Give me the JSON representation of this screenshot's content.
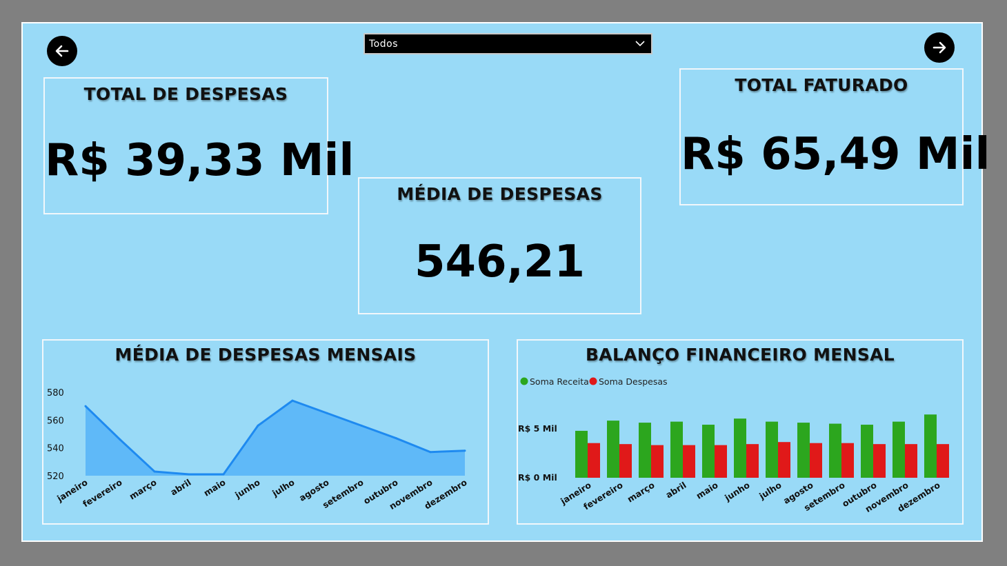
{
  "filter": {
    "selected": "Todos",
    "icon": "chevron-down-icon"
  },
  "nav": {
    "back_icon": "arrow-left-icon",
    "forward_icon": "arrow-right-icon"
  },
  "kpi": {
    "total_despesas": {
      "title": "TOTAL DE DESPESAS",
      "value": "R$ 39,33 Mil"
    },
    "total_faturado": {
      "title": "TOTAL FATURADO",
      "value": "R$ 65,49 Mil"
    },
    "media_despesas": {
      "title": "MÉDIA DE DESPESAS",
      "value": "546,21"
    }
  },
  "colors": {
    "background": "#99daf7",
    "area_fill": "#5fb9f8",
    "line": "#1e8af0",
    "receita": "#2ca61e",
    "despesas": "#e01919"
  },
  "chart_data": [
    {
      "type": "area",
      "title": "MÉDIA DE DESPESAS MENSAIS",
      "categories": [
        "janeiro",
        "fevereiro",
        "março",
        "abril",
        "maio",
        "junho",
        "julho",
        "agosto",
        "setembro",
        "outubro",
        "novembro",
        "dezembro"
      ],
      "values": [
        570,
        546,
        523,
        521,
        521,
        556,
        574,
        565,
        556,
        547,
        537,
        538
      ],
      "yticks": [
        "520",
        "540",
        "560",
        "580"
      ],
      "ylim": [
        520,
        580
      ],
      "grid": false
    },
    {
      "type": "bar",
      "title": "BALANÇO FINANCEIRO MENSAL",
      "categories": [
        "janeiro",
        "fevereiro",
        "março",
        "abril",
        "maio",
        "junho",
        "julho",
        "agosto",
        "setembro",
        "outubro",
        "novembro",
        "dezembro"
      ],
      "series": [
        {
          "name": "Soma Receita",
          "values": [
            4.6,
            5.6,
            5.4,
            5.5,
            5.2,
            5.8,
            5.5,
            5.4,
            5.3,
            5.2,
            5.5,
            6.2
          ]
        },
        {
          "name": "Soma Despesas",
          "values": [
            3.4,
            3.3,
            3.2,
            3.2,
            3.2,
            3.3,
            3.5,
            3.4,
            3.4,
            3.3,
            3.3,
            3.3
          ]
        }
      ],
      "yticks": [
        "R$ 0 Mil",
        "R$ 5 Mil"
      ],
      "ylim": [
        0,
        5
      ],
      "legend": "top-left",
      "grid": false
    }
  ]
}
